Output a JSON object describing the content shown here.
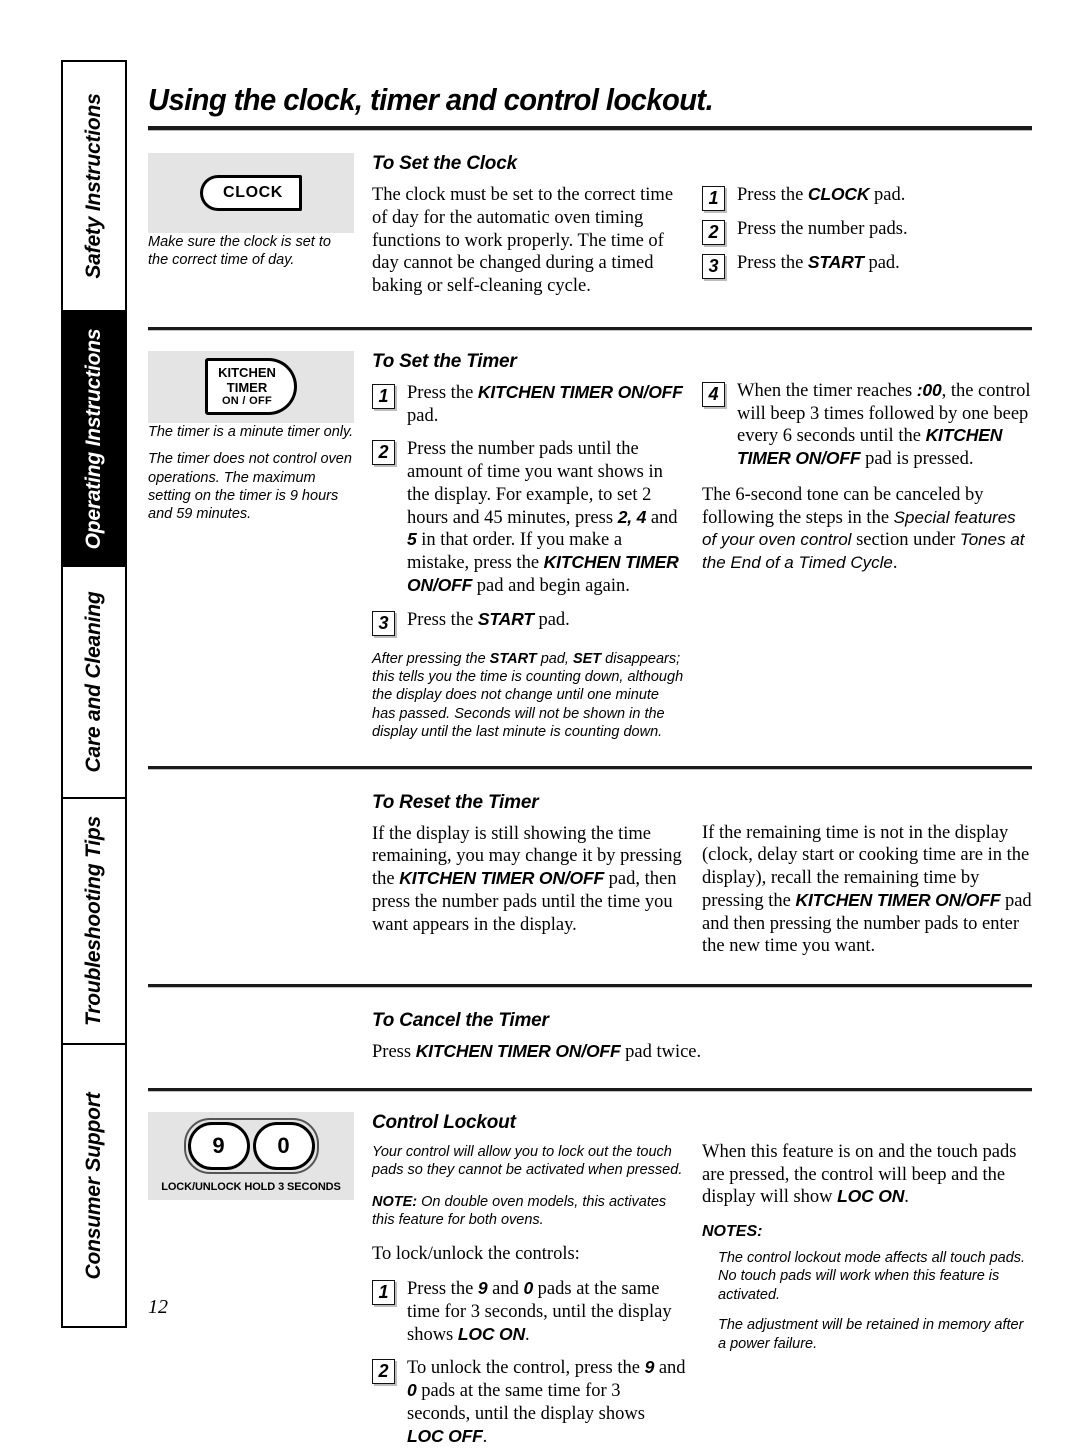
{
  "page": {
    "title": "Using the clock, timer and control lockout.",
    "number": "12"
  },
  "sidebar": {
    "items": [
      {
        "label": "Safety Instructions",
        "active": false
      },
      {
        "label": "Operating Instructions",
        "active": true
      },
      {
        "label": "Care and Cleaning",
        "active": false
      },
      {
        "label": "Troubleshooting Tips",
        "active": false
      },
      {
        "label": "Consumer Support",
        "active": false
      }
    ]
  },
  "clock_section": {
    "heading": "To Set the Clock",
    "pad_label": "CLOCK",
    "caption": "Make sure the clock is set to the correct time of day.",
    "body": "The clock must be set to the correct time of day for the automatic oven timing functions to work properly. The time of day cannot be changed during a timed baking or self-cleaning cycle.",
    "steps": [
      {
        "num": "1",
        "pre": "Press the ",
        "strong": "CLOCK",
        "post": " pad."
      },
      {
        "num": "2",
        "pre": "Press the number pads.",
        "strong": "",
        "post": ""
      },
      {
        "num": "3",
        "pre": "Press the ",
        "strong": "START",
        "post": " pad."
      }
    ]
  },
  "timer_section": {
    "heading": "To Set the Timer",
    "pad_line1": "KITCHEN",
    "pad_line2": "TIMER",
    "pad_line3": "ON / OFF",
    "caption1": "The timer is a minute timer only.",
    "caption2": "The timer does not control oven operations. The maximum setting on the timer is 9 hours and 59 minutes.",
    "step1_num": "1",
    "step1_a": "Press the ",
    "step1_b": "KITCHEN TIMER ON/OFF",
    "step1_c": " pad.",
    "step2_num": "2",
    "step2_a": "Press the number pads until the amount of time you want shows in the display. For example, to set 2 hours and 45 minutes, press ",
    "step2_b": "2, 4",
    "step2_c": " and ",
    "step2_d": "5",
    "step2_e": " in that order. If you make a mistake, press the ",
    "step2_f": "KITCHEN TIMER ON/OFF",
    "step2_g": " pad and begin again.",
    "step3_num": "3",
    "step3_a": "Press the ",
    "step3_b": "START",
    "step3_c": " pad.",
    "after_note_a": "After pressing the ",
    "after_note_b": "START",
    "after_note_c": " pad, ",
    "after_note_d": "SET",
    "after_note_e": " disappears; this tells you the time is counting down, although the display does not change until one minute has passed. Seconds will not be shown in the display until the last minute is counting down.",
    "step4_num": "4",
    "step4_a": "When the timer reaches ",
    "step4_b": ":00",
    "step4_c": ", the control will beep 3 times followed by one beep every 6 seconds until the ",
    "step4_d": "KITCHEN TIMER ON/OFF",
    "step4_e": " pad is pressed.",
    "tone_a": "The 6-second tone can be canceled by following the steps in the ",
    "tone_b": "Special features of your oven control",
    "tone_c": " section under ",
    "tone_d": "Tones at the End of a Timed Cycle",
    "tone_e": "."
  },
  "reset_section": {
    "heading": "To Reset the Timer",
    "left_a": "If the display is still showing the time remaining, you may change it by pressing the ",
    "left_b": "KITCHEN TIMER ON/OFF",
    "left_c": " pad, then press the number pads until the time you want appears in the display.",
    "right_a": "If the remaining time is not in the display (clock, delay start or cooking time are in the display), recall the remaining time by pressing the ",
    "right_b": "KITCHEN TIMER ON/OFF",
    "right_c": " pad and then pressing the number pads to enter the new time you want."
  },
  "cancel_section": {
    "heading": "To Cancel the Timer",
    "body_a": "Press ",
    "body_b": "KITCHEN TIMER ON/OFF",
    "body_c": " pad twice."
  },
  "lockout_section": {
    "heading": "Control Lockout",
    "key_9": "9",
    "key_0": "0",
    "key_label": "LOCK/UNLOCK HOLD 3 SECONDS",
    "intro": "Your control will allow you to lock out the touch pads so they cannot be activated when pressed.",
    "note_label": "NOTE:",
    "note_text": " On double oven models, this activates this feature for both ovens.",
    "lead": "To lock/unlock the controls:",
    "step1_num": "1",
    "step1_a": "Press the ",
    "step1_b": "9",
    "step1_c": " and ",
    "step1_d": "0",
    "step1_e": " pads at the same time for 3 seconds, until the display shows ",
    "step1_f": "LOC ON",
    "step1_g": ".",
    "step2_num": "2",
    "step2_a": "To unlock the control, press the ",
    "step2_b": "9",
    "step2_c": " and ",
    "step2_d": "0",
    "step2_e": " pads at the same time for 3 seconds, until the display shows ",
    "step2_f": "LOC OFF",
    "step2_g": ".",
    "right_a": "When this feature is on and the touch pads are pressed, the control will beep and the display will show ",
    "right_b": "LOC ON",
    "right_c": ".",
    "notes_head": "NOTES:",
    "note_1": "The control lockout mode affects all touch pads. No touch pads will work when this feature is activated.",
    "note_2": "The adjustment will be retained in memory after a power failure."
  }
}
